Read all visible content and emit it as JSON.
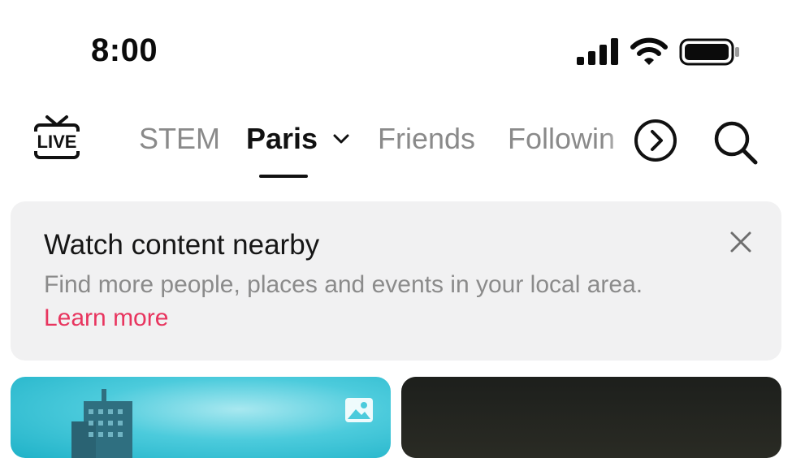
{
  "status_bar": {
    "time": "8:00",
    "icons": [
      "cellular-signal-icon",
      "wifi-icon",
      "battery-icon"
    ]
  },
  "top_nav": {
    "live_label": "LIVE",
    "tabs": [
      {
        "label": "STEM",
        "active": false
      },
      {
        "label": "Paris",
        "active": true
      },
      {
        "label": "Friends",
        "active": false
      },
      {
        "label": "Followin",
        "active": false
      }
    ],
    "icons": [
      "live-icon",
      "chevron-down-icon",
      "chevron-right-circle-icon",
      "search-icon"
    ]
  },
  "banner": {
    "title": "Watch content nearby",
    "body": "Find more people, places and events in your local area.",
    "link": "Learn more",
    "icons": [
      "close-icon"
    ]
  },
  "feed": {
    "cards": [
      {
        "type": "photo",
        "badge_icon": "image-icon"
      },
      {
        "type": "video"
      }
    ]
  },
  "colors": {
    "accent_link": "#e8355f",
    "banner_bg": "#f1f1f2",
    "inactive_tab": "#8a8a8a",
    "active_tab": "#111111"
  }
}
